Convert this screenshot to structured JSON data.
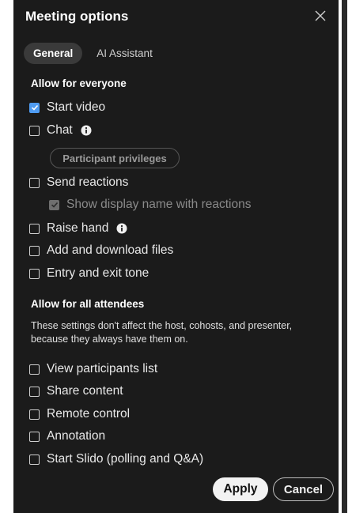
{
  "header": {
    "title": "Meeting options"
  },
  "tabs": [
    {
      "label": "General",
      "active": true
    },
    {
      "label": "AI Assistant",
      "active": false
    }
  ],
  "everyone": {
    "title": "Allow for everyone",
    "items": [
      {
        "label": "Start video",
        "checked": true
      },
      {
        "label": "Chat",
        "checked": false,
        "info": true
      },
      {
        "label": "Send reactions",
        "checked": false
      },
      {
        "label": "Show display name with reactions",
        "checked": true,
        "disabled": true
      },
      {
        "label": "Raise hand",
        "checked": false,
        "info": true
      },
      {
        "label": "Add and download files",
        "checked": false
      },
      {
        "label": "Entry and exit tone",
        "checked": false
      }
    ],
    "privileges_label": "Participant privileges"
  },
  "attendees": {
    "title": "Allow for all attendees",
    "description": "These settings don't affect the host, cohosts, and presenter, because they always have them on.",
    "items": [
      {
        "label": "View participants list",
        "checked": false
      },
      {
        "label": "Share content",
        "checked": false
      },
      {
        "label": "Remote control",
        "checked": false
      },
      {
        "label": "Annotation",
        "checked": false
      },
      {
        "label": "Start Slido (polling and Q&A)",
        "checked": false
      }
    ]
  },
  "footer": {
    "apply_label": "Apply",
    "cancel_label": "Cancel"
  },
  "colors": {
    "background": "#1b1b1b",
    "accent": "#4f9cf2"
  },
  "icons": {
    "close": "close-icon",
    "info": "info-icon",
    "check": "check-icon"
  }
}
